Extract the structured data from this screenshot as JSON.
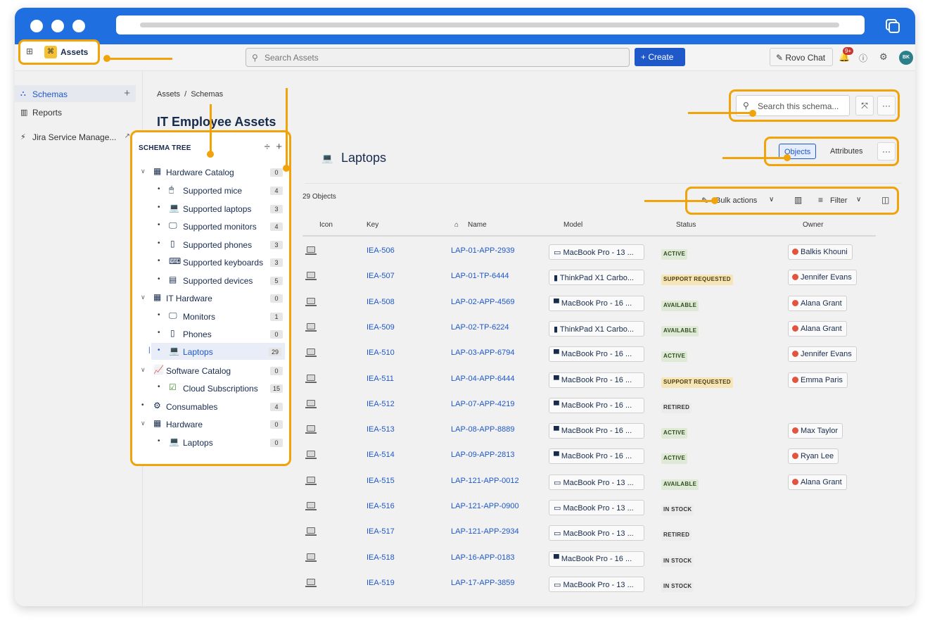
{
  "topnav": {
    "app_name": "Assets",
    "search_placeholder": "Search Assets",
    "create_label": "Create",
    "rovo_label": "Rovo Chat",
    "notif_badge": "9+",
    "avatar_initials": "BK"
  },
  "sidebar": {
    "items": [
      {
        "label": "Schemas",
        "icon": "hierarchy-icon"
      },
      {
        "label": "Reports",
        "icon": "chart-icon"
      },
      {
        "label": "Jira Service Manage...",
        "icon": "bolt-icon"
      }
    ]
  },
  "breadcrumb": {
    "root": "Assets",
    "sep": "/",
    "current": "Schemas"
  },
  "page_title": "IT Employee Assets",
  "schema_search_placeholder": "Search this schema...",
  "tree": {
    "title": "SCHEMA TREE",
    "nodes": [
      {
        "label": "Hardware Catalog",
        "count": "0"
      },
      {
        "label": "Supported mice",
        "count": "4"
      },
      {
        "label": "Supported laptops",
        "count": "3"
      },
      {
        "label": "Supported monitors",
        "count": "4"
      },
      {
        "label": "Supported phones",
        "count": "3"
      },
      {
        "label": "Supported keyboards",
        "count": "3"
      },
      {
        "label": "Supported devices",
        "count": "5"
      },
      {
        "label": "IT Hardware",
        "count": "0"
      },
      {
        "label": "Monitors",
        "count": "1"
      },
      {
        "label": "Phones",
        "count": "0"
      },
      {
        "label": "Laptops",
        "count": "29"
      },
      {
        "label": "Software Catalog",
        "count": "0"
      },
      {
        "label": "Cloud Subscriptions",
        "count": "15"
      },
      {
        "label": "Consumables",
        "count": "4"
      },
      {
        "label": "Hardware",
        "count": "0"
      },
      {
        "label": "Laptops",
        "count": "0"
      }
    ]
  },
  "object_type": {
    "title": "Laptops",
    "tab_objects": "Objects",
    "tab_attributes": "Attributes",
    "count_label": "29 Objects",
    "bulk_actions": "Bulk actions",
    "filter": "Filter"
  },
  "table": {
    "headers": {
      "icon": "Icon",
      "key": "Key",
      "name": "Name",
      "model": "Model",
      "status": "Status",
      "owner": "Owner"
    },
    "rows": [
      {
        "key": "IEA-506",
        "name": "LAP-01-APP-2939",
        "model": "MacBook Pro - 13 ...",
        "status": "ACTIVE",
        "owner": "Balkis Khouni"
      },
      {
        "key": "IEA-507",
        "name": "LAP-01-TP-6444",
        "model": "ThinkPad X1 Carbo...",
        "status": "SUPPORT REQUESTED",
        "owner": "Jennifer Evans"
      },
      {
        "key": "IEA-508",
        "name": "LAP-02-APP-4569",
        "model": "MacBook Pro - 16 ...",
        "status": "AVAILABLE",
        "owner": "Alana Grant"
      },
      {
        "key": "IEA-509",
        "name": "LAP-02-TP-6224",
        "model": "ThinkPad X1 Carbo...",
        "status": "AVAILABLE",
        "owner": "Alana Grant"
      },
      {
        "key": "IEA-510",
        "name": "LAP-03-APP-6794",
        "model": "MacBook Pro - 16 ...",
        "status": "ACTIVE",
        "owner": "Jennifer Evans"
      },
      {
        "key": "IEA-511",
        "name": "LAP-04-APP-6444",
        "model": "MacBook Pro - 16 ...",
        "status": "SUPPORT REQUESTED",
        "owner": "Emma Paris"
      },
      {
        "key": "IEA-512",
        "name": "LAP-07-APP-4219",
        "model": "MacBook Pro - 16 ...",
        "status": "RETIRED",
        "owner": ""
      },
      {
        "key": "IEA-513",
        "name": "LAP-08-APP-8889",
        "model": "MacBook Pro - 16 ...",
        "status": "ACTIVE",
        "owner": "Max Taylor"
      },
      {
        "key": "IEA-514",
        "name": "LAP-09-APP-2813",
        "model": "MacBook Pro - 16 ...",
        "status": "ACTIVE",
        "owner": "Ryan Lee"
      },
      {
        "key": "IEA-515",
        "name": "LAP-121-APP-0012",
        "model": "MacBook Pro - 13 ...",
        "status": "AVAILABLE",
        "owner": "Alana Grant"
      },
      {
        "key": "IEA-516",
        "name": "LAP-121-APP-0900",
        "model": "MacBook Pro - 13 ...",
        "status": "IN STOCK",
        "owner": ""
      },
      {
        "key": "IEA-517",
        "name": "LAP-121-APP-2934",
        "model": "MacBook Pro - 13 ...",
        "status": "RETIRED",
        "owner": ""
      },
      {
        "key": "IEA-518",
        "name": "LAP-16-APP-0183",
        "model": "MacBook Pro - 16 ...",
        "status": "IN STOCK",
        "owner": ""
      },
      {
        "key": "IEA-519",
        "name": "LAP-17-APP-3859",
        "model": "MacBook Pro - 13 ...",
        "status": "IN STOCK",
        "owner": ""
      }
    ]
  },
  "colors": {
    "accent": "#1f58c9",
    "highlight": "#f0a30a",
    "chrome": "#1f6fe0"
  }
}
